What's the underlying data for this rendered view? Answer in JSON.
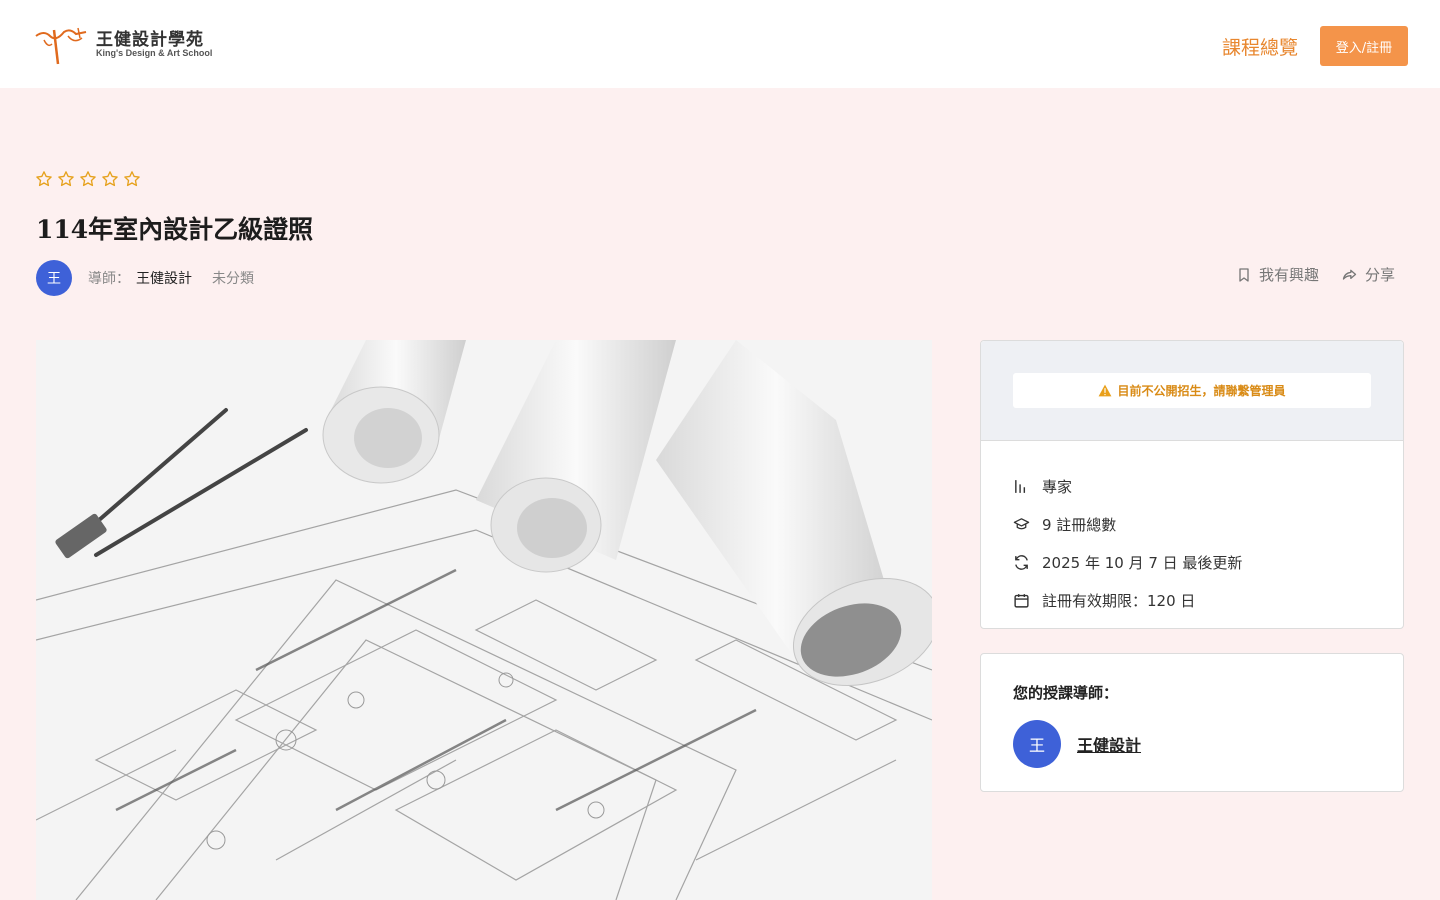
{
  "header": {
    "logo_cn": "王健設計學苑",
    "logo_en": "King's Design & Art School",
    "nav_courses": "課程總覽",
    "login_label": "登入/註冊"
  },
  "course": {
    "rating_stars_filled": 0,
    "rating_stars_total": 5,
    "title": "114年室內設計乙級證照",
    "instructor_avatar": "王",
    "instructor_label": "導師：",
    "instructor_name": "王健設計",
    "category": "未分類",
    "wishlist_label": "我有興趣",
    "share_label": "分享"
  },
  "sidebar": {
    "notice": "目前不公開招生，請聯繫管理員",
    "level": "專家",
    "enrolled": "9 註冊總數",
    "updated": "2025 年 10 月 7 日 最後更新",
    "validity": "註冊有效期限：120 日"
  },
  "instructors": {
    "heading": "您的授課導師：",
    "avatar": "王",
    "name": "王健設計"
  },
  "colors": {
    "accent": "#e8872f",
    "button": "#f4944a",
    "avatar": "#3e61d8",
    "page_bg": "#fdf0f0",
    "warning": "#d98b16"
  }
}
